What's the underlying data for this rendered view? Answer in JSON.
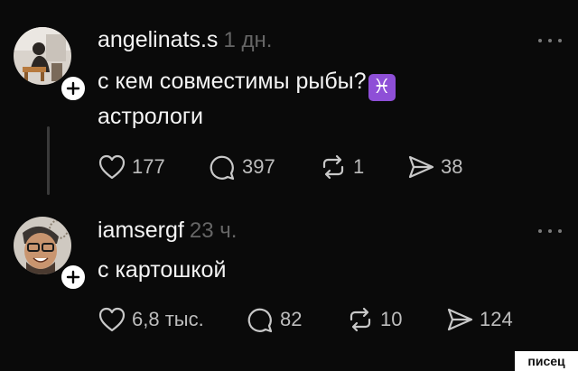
{
  "posts": [
    {
      "username": "angelinats.s",
      "time": "1 дн.",
      "text_line1": "с кем совместимы рыбы?",
      "emoji": "♓",
      "text_line2": "астрологи",
      "likes": "177",
      "comments": "397",
      "reposts": "1",
      "shares": "38"
    },
    {
      "username": "iamsergf",
      "time": "23 ч.",
      "text": "с картошкой",
      "likes": "6,8 тыс.",
      "comments": "82",
      "reposts": "10",
      "shares": "124"
    }
  ],
  "watermark": "писец",
  "colors": {
    "background": "#0a0a0a",
    "text": "#f3f3f3",
    "muted": "#666666",
    "accent_emoji": "#8e4fd7"
  }
}
